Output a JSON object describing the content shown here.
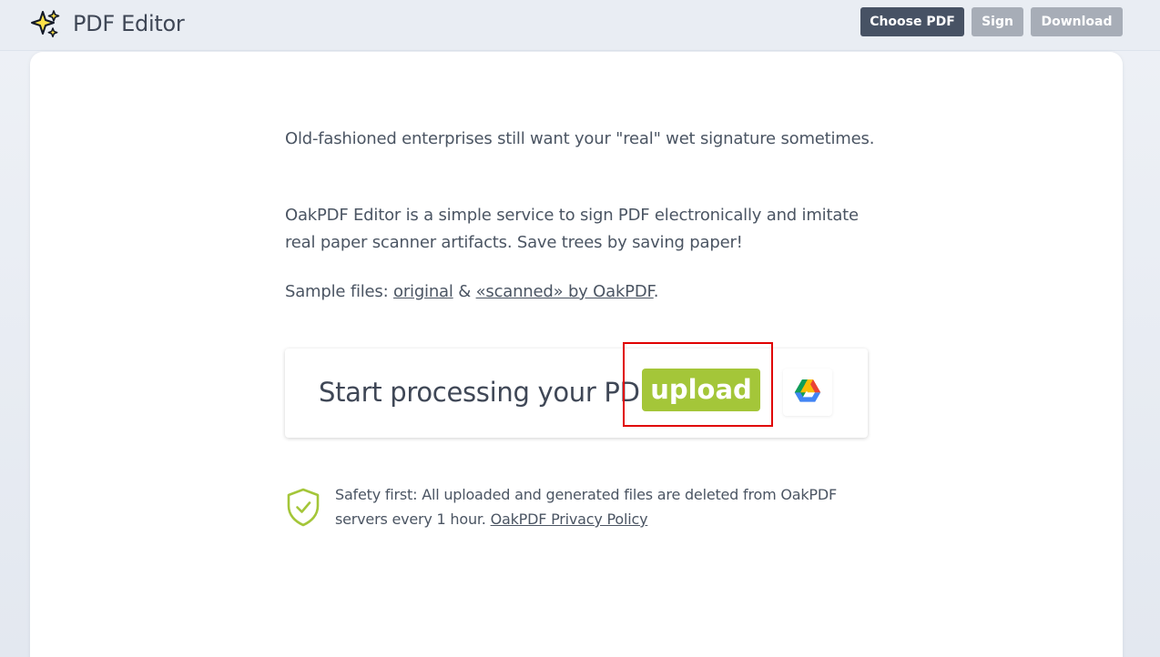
{
  "header": {
    "title": "PDF Editor",
    "logo_icon": "sparkles-icon",
    "buttons": {
      "choose_pdf": "Choose PDF",
      "sign": "Sign",
      "download": "Download"
    }
  },
  "intro": {
    "paragraph_1": "Old-fashioned enterprises still want your \"real\" wet signature sometimes.",
    "paragraph_2": "OakPDF Editor is a simple service to sign PDF electronically and imitate real paper scanner artifacts. Save trees by saving paper!",
    "samples_prefix": "Sample files: ",
    "sample_original": "original",
    "samples_and": " & ",
    "sample_scanned": "«scanned» by OakPDF",
    "samples_suffix": "."
  },
  "upload": {
    "prompt": "Start processing your PDF:",
    "button_label": "upload",
    "gdrive_icon": "google-drive-icon"
  },
  "safety": {
    "icon": "shield-check-icon",
    "text": "Safety first: All uploaded and generated files are deleted from OakPDF servers every 1 hour. ",
    "policy_link": "OakPDF Privacy Policy"
  },
  "colors": {
    "upload_green": "#a4c639",
    "dark_button": "#475264",
    "disabled_button": "#a7adb7",
    "highlight_red": "#e00000"
  }
}
